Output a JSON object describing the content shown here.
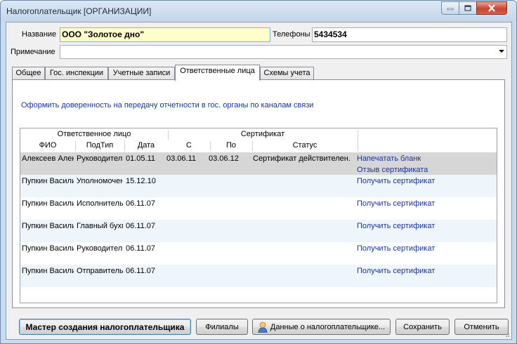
{
  "window": {
    "title": "Налогоплательщик [ОРГАНИЗАЦИИ]"
  },
  "form": {
    "name_label": "Название",
    "name_value": "ООО \"Золотое дно\"",
    "phones_label": "Телефоны",
    "phones_value": "5434534",
    "note_label": "Примечание",
    "note_value": ""
  },
  "tabs": [
    "Общее",
    "Гос. инспекции",
    "Учетные записи",
    "Ответственные лица",
    "Схемы учета"
  ],
  "active_tab": "Ответственные лица",
  "panel": {
    "power_of_attorney_link": "Оформить доверенность на передачу отчетности в гос. органы по каналам связи"
  },
  "grid": {
    "group_headers": {
      "responsible": "Ответственное лицо",
      "certificate": "Сертификат"
    },
    "columns": [
      "ФИО",
      "ПодТип",
      "Дата",
      "С",
      "По",
      "Статус"
    ],
    "rows": [
      {
        "fio": "Алексеев Алексей",
        "subtype": "Руководитель",
        "date": "01.05.11",
        "from": "03.06.11",
        "to": "03.06.12",
        "status": "Сертификат действителен.",
        "links": [
          "Напечатать бланк",
          "Отзыв сертификата"
        ],
        "selected": true
      },
      {
        "fio": "Пупкин Василий",
        "subtype": "Уполномоченный",
        "date": "15.12.10",
        "from": "",
        "to": "",
        "status": "",
        "links": [
          "Получить сертификат"
        ]
      },
      {
        "fio": "Пупкин Василий",
        "subtype": "Исполнитель",
        "date": "06.11.07",
        "from": "",
        "to": "",
        "status": "",
        "links": [
          "Получить сертификат"
        ]
      },
      {
        "fio": "Пупкин Василий",
        "subtype": "Главный бухгалтер",
        "date": "06.11.07",
        "from": "",
        "to": "",
        "status": "",
        "links": [
          "Получить сертификат"
        ]
      },
      {
        "fio": "Пупкин Василий",
        "subtype": "Руководитель",
        "date": "06.11.07",
        "from": "",
        "to": "",
        "status": "",
        "links": [
          "Получить сертификат"
        ]
      },
      {
        "fio": "Пупкин Василий",
        "subtype": "Отправитель",
        "date": "06.11.07",
        "from": "",
        "to": "",
        "status": "",
        "links": [
          "Получить сертификат"
        ]
      }
    ]
  },
  "buttons": {
    "wizard": "Мастер создания налогоплательщика",
    "branches": "Филиалы",
    "taxpayer_data": "Данные о налогоплательщике...",
    "save": "Сохранить",
    "cancel": "Отменить"
  },
  "colors": {
    "link": "#1a33a0",
    "selected_row": "#d6d6d6",
    "alt_row": "#eef5fb",
    "name_field_bg": "#ffffcc"
  }
}
